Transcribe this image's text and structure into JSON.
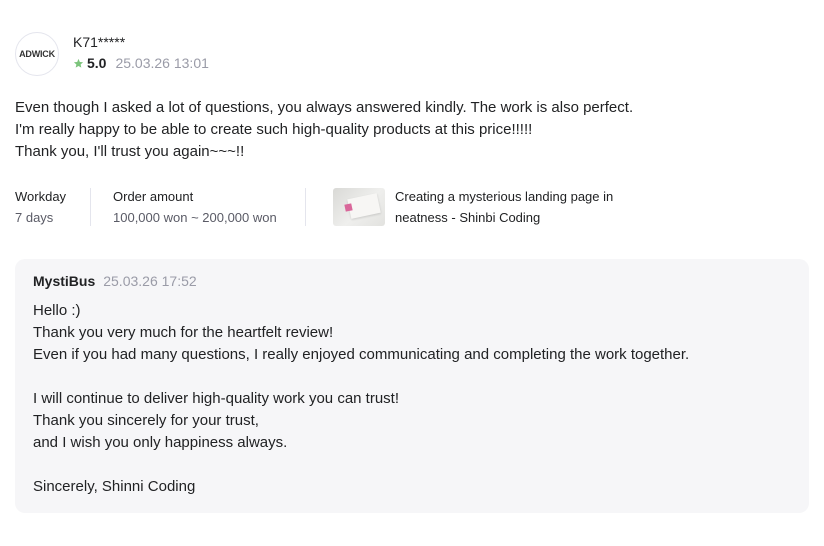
{
  "review": {
    "avatar_text": "ADWICK",
    "username": "K71*****",
    "rating": "5.0",
    "date": "25.03.26 13:01",
    "star_color": "#7cc47c",
    "lines": [
      "Even though I asked a lot of questions, you always answered kindly. The work is also perfect.",
      "I'm really happy to be able to create such high-quality products at this price!!!!!",
      "Thank you, I'll trust you again~~~!!"
    ]
  },
  "details": {
    "workday_label": "Workday",
    "workday_value": "7 days",
    "order_label": "Order amount",
    "order_value": "100,000 won ~ 200,000 won",
    "service_title_line1": "Creating a mysterious landing page in",
    "service_title_line2": "neatness - Shinbi Coding"
  },
  "reply": {
    "seller": "MystiBus",
    "date": "25.03.26 17:52",
    "lines": [
      "Hello :)",
      "Thank you very much for the heartfelt review!",
      "Even if you had many questions, I really enjoyed communicating and completing the work together.",
      "",
      "I will continue to deliver high-quality work you can trust!",
      "Thank you sincerely for your trust,",
      "and I wish you only happiness always.",
      "",
      "Sincerely, Shinni Coding"
    ]
  }
}
